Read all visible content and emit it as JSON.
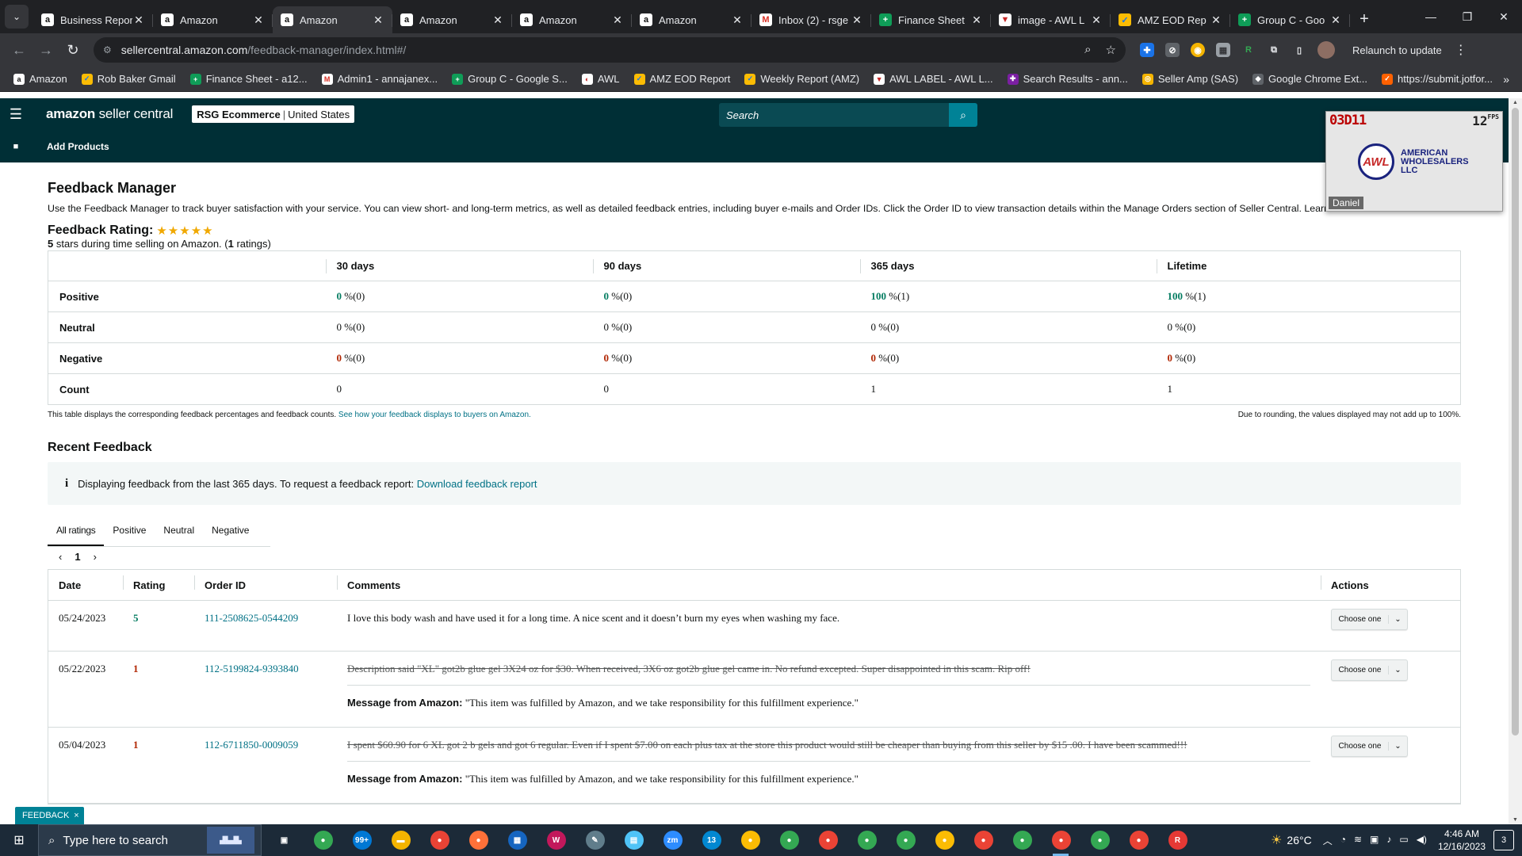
{
  "browser": {
    "tabs": [
      {
        "favicon": "amazon",
        "favicon_glyph": "a",
        "title": "Business Repor",
        "active": false
      },
      {
        "favicon": "amazon",
        "favicon_glyph": "a",
        "title": "Amazon",
        "active": false
      },
      {
        "favicon": "amazon",
        "favicon_glyph": "a",
        "title": "Amazon",
        "active": true
      },
      {
        "favicon": "amazon",
        "favicon_glyph": "a",
        "title": "Amazon",
        "active": false
      },
      {
        "favicon": "amazon",
        "favicon_glyph": "a",
        "title": "Amazon",
        "active": false
      },
      {
        "favicon": "amazon",
        "favicon_glyph": "a",
        "title": "Amazon",
        "active": false
      },
      {
        "favicon": "gmail",
        "favicon_glyph": "M",
        "title": "Inbox (2) - rsge",
        "active": false
      },
      {
        "favicon": "sheets",
        "favicon_glyph": "+",
        "title": "Finance Sheet",
        "active": false
      },
      {
        "favicon": "awl",
        "favicon_glyph": "▼",
        "title": "image - AWL L",
        "active": false
      },
      {
        "favicon": "eod",
        "favicon_glyph": "✓",
        "title": "AMZ EOD Rep",
        "active": false
      },
      {
        "favicon": "sheets",
        "favicon_glyph": "+",
        "title": "Group C - Goo",
        "active": false
      }
    ],
    "url_host": "sellercentral.amazon.com",
    "url_path": "/feedback-manager/index.html#/",
    "relaunch_label": "Relaunch to update",
    "bookmarks": [
      {
        "icon": "amazon",
        "glyph": "a",
        "label": "Amazon"
      },
      {
        "icon": "rb",
        "glyph": "✓",
        "label": "Rob Baker Gmail"
      },
      {
        "icon": "sheets",
        "glyph": "+",
        "label": "Finance Sheet - a12..."
      },
      {
        "icon": "gmail",
        "glyph": "M",
        "label": "Admin1 - annajanex..."
      },
      {
        "icon": "sheets",
        "glyph": "+",
        "label": "Group C - Google S..."
      },
      {
        "icon": "awl",
        "glyph": "◐",
        "label": "AWL"
      },
      {
        "icon": "eod",
        "glyph": "✓",
        "label": "AMZ EOD Report"
      },
      {
        "icon": "eod",
        "glyph": "✓",
        "label": "Weekly Report (AMZ)"
      },
      {
        "icon": "awl",
        "glyph": "▼",
        "label": "AWL LABEL - AWL L..."
      },
      {
        "icon": "search",
        "glyph": "✚",
        "label": "Search Results - ann..."
      },
      {
        "icon": "sas",
        "glyph": "◎",
        "label": "Seller Amp (SAS)"
      },
      {
        "icon": "chrome",
        "glyph": "◆",
        "label": "Google Chrome Ext..."
      },
      {
        "icon": "jotform",
        "glyph": "✓",
        "label": "https://submit.jotfor..."
      }
    ]
  },
  "header": {
    "logo_bold": "amazon",
    "logo_rest": " seller central",
    "store_name": "RSG Ecommerce",
    "store_sep": "|",
    "store_country": "United States",
    "search_placeholder": "Search",
    "subnav_link": "Add Products"
  },
  "page": {
    "title": "Feedback Manager",
    "description": "Use the Feedback Manager to track buyer satisfaction with your service. You can view short- and long-term metrics, as well as detailed feedback entries, including buyer e-mails and Order IDs. Click the Order ID to view transaction details within the Manage Orders section of Seller Central. Learn more",
    "rating_heading": "Feedback Rating:",
    "stars": "★★★★★",
    "rating_sub_num": "5",
    "rating_sub_mid": " stars during time selling on Amazon. (",
    "rating_sub_count": "1",
    "rating_sub_end": " ratings)"
  },
  "metrics": {
    "columns": [
      "30 days",
      "90 days",
      "365 days",
      "Lifetime"
    ],
    "rows": [
      {
        "label": "Positive",
        "cells": [
          {
            "num": "0",
            "rest": " %(0)",
            "tone": "green"
          },
          {
            "num": "0",
            "rest": " %(0)",
            "tone": "green"
          },
          {
            "num": "100",
            "rest": " %(1)",
            "tone": "green"
          },
          {
            "num": "100",
            "rest": " %(1)",
            "tone": "green"
          }
        ]
      },
      {
        "label": "Neutral",
        "cells": [
          {
            "num": "0",
            "rest": " %(0)",
            "tone": "black"
          },
          {
            "num": "0",
            "rest": " %(0)",
            "tone": "black"
          },
          {
            "num": "0",
            "rest": " %(0)",
            "tone": "black"
          },
          {
            "num": "0",
            "rest": " %(0)",
            "tone": "black"
          }
        ]
      },
      {
        "label": "Negative",
        "cells": [
          {
            "num": "0",
            "rest": " %(0)",
            "tone": "red"
          },
          {
            "num": "0",
            "rest": " %(0)",
            "tone": "red"
          },
          {
            "num": "0",
            "rest": " %(0)",
            "tone": "red"
          },
          {
            "num": "0",
            "rest": " %(0)",
            "tone": "red"
          }
        ]
      },
      {
        "label": "Count",
        "cells": [
          {
            "num": "0",
            "rest": "",
            "tone": "black"
          },
          {
            "num": "0",
            "rest": "",
            "tone": "black"
          },
          {
            "num": "1",
            "rest": "",
            "tone": "black"
          },
          {
            "num": "1",
            "rest": "",
            "tone": "black"
          }
        ]
      }
    ],
    "footnote_left": "This table displays the corresponding feedback percentages and feedback counts. ",
    "footnote_link": "See how your feedback displays to buyers on Amazon.",
    "footnote_right": "Due to rounding, the values displayed may not add up to 100%."
  },
  "recent": {
    "title": "Recent Feedback",
    "info_icon": "i",
    "info_text": "Displaying feedback from the last 365 days. To request a feedback report: ",
    "info_link": "Download feedback report",
    "tabs": [
      "All ratings",
      "Positive",
      "Neutral",
      "Negative"
    ],
    "active_tab": 0,
    "page_prev": "‹",
    "page_num": "1",
    "page_next": "›",
    "columns": {
      "date": "Date",
      "rating": "Rating",
      "order": "Order ID",
      "comments": "Comments",
      "actions": "Actions"
    },
    "rows": [
      {
        "date": "05/24/2023",
        "rating": "5",
        "rating_tone": "green",
        "order_id": "111-2508625-0544209",
        "comment": "I love this body wash and have used it for a long time. A nice scent and it doesn’t burn my eyes when washing my face.",
        "struck": false,
        "message_label": "",
        "message_text": "",
        "action_label": "Choose one"
      },
      {
        "date": "05/22/2023",
        "rating": "1",
        "rating_tone": "red",
        "order_id": "112-5199824-9393840",
        "comment": "Description said \"XL\" got2b glue gel 3X24 oz for $30. When received, 3X6 oz got2b glue gel came in. No refund excepted. Super disappointed in this scam. Rip off!",
        "struck": true,
        "message_label": "Message from Amazon:",
        "message_text": " \"This item was fulfilled by Amazon, and we take responsibility for this fulfillment experience.\"",
        "action_label": "Choose one"
      },
      {
        "date": "05/04/2023",
        "rating": "1",
        "rating_tone": "red",
        "order_id": "112-6711850-0009059",
        "comment": "I spent $60.90 for 6 XL got 2 b gels and got 6 regular. Even if I spent $7.00 on each plus tax at the store this product would still be cheaper than buying from this seller by $15 .00. I have been scammed!!!",
        "struck": true,
        "message_label": "Message from Amazon:",
        "message_text": " \"This item was fulfilled by Amazon, and we take responsibility for this fulfillment experience.\"",
        "action_label": "Choose one"
      }
    ]
  },
  "feedback_badge": {
    "label": "FEEDBACK",
    "close": "×"
  },
  "video_overlay": {
    "timer": "03D11",
    "fps": "12",
    "fps_unit": "FPS",
    "brand_mark": "AWL",
    "brand_text": "AMERICAN WHOLESALERS LLC",
    "name": "Daniel"
  },
  "taskbar": {
    "search_placeholder": "Type here to search",
    "apps": [
      {
        "name": "task-view",
        "glyph": "▣",
        "color": "#1c2a38"
      },
      {
        "name": "chrome",
        "glyph": "●",
        "color": "#34a853"
      },
      {
        "name": "mail",
        "glyph": "99+",
        "color": "#0078d4"
      },
      {
        "name": "file-explorer",
        "glyph": "▬",
        "color": "#f4b400"
      },
      {
        "name": "chrome-profile",
        "glyph": "●",
        "color": "#ea4335"
      },
      {
        "name": "firefox",
        "glyph": "●",
        "color": "#ff7139"
      },
      {
        "name": "calculator",
        "glyph": "▦",
        "color": "#1565c0"
      },
      {
        "name": "wps",
        "glyph": "W",
        "color": "#c2185b"
      },
      {
        "name": "paint",
        "glyph": "✎",
        "color": "#607d8b"
      },
      {
        "name": "notepad",
        "glyph": "▤",
        "color": "#4fc3f7"
      },
      {
        "name": "zoom",
        "glyph": "zm",
        "color": "#2d8cff"
      },
      {
        "name": "messenger",
        "glyph": "13",
        "color": "#0288d1"
      },
      {
        "name": "chrome-1",
        "glyph": "●",
        "color": "#fbbc04"
      },
      {
        "name": "chrome-2",
        "glyph": "●",
        "color": "#34a853"
      },
      {
        "name": "chrome-3",
        "glyph": "●",
        "color": "#ea4335"
      },
      {
        "name": "chrome-4",
        "glyph": "●",
        "color": "#34a853"
      },
      {
        "name": "chrome-5",
        "glyph": "●",
        "color": "#34a853"
      },
      {
        "name": "chrome-6",
        "glyph": "●",
        "color": "#fbbc04"
      },
      {
        "name": "chrome-7",
        "glyph": "●",
        "color": "#ea4335"
      },
      {
        "name": "chrome-8",
        "glyph": "●",
        "color": "#34a853"
      },
      {
        "name": "chrome-9",
        "glyph": "●",
        "color": "#ea4335"
      },
      {
        "name": "chrome-10",
        "glyph": "●",
        "color": "#34a853"
      },
      {
        "name": "chrome-11",
        "glyph": "●",
        "color": "#ea4335"
      },
      {
        "name": "r-app",
        "glyph": "R",
        "color": "#e53935"
      }
    ],
    "active_app": 20,
    "temperature": "26°C",
    "time": "4:46 AM",
    "date": "12/16/2023",
    "notifications": "3"
  }
}
